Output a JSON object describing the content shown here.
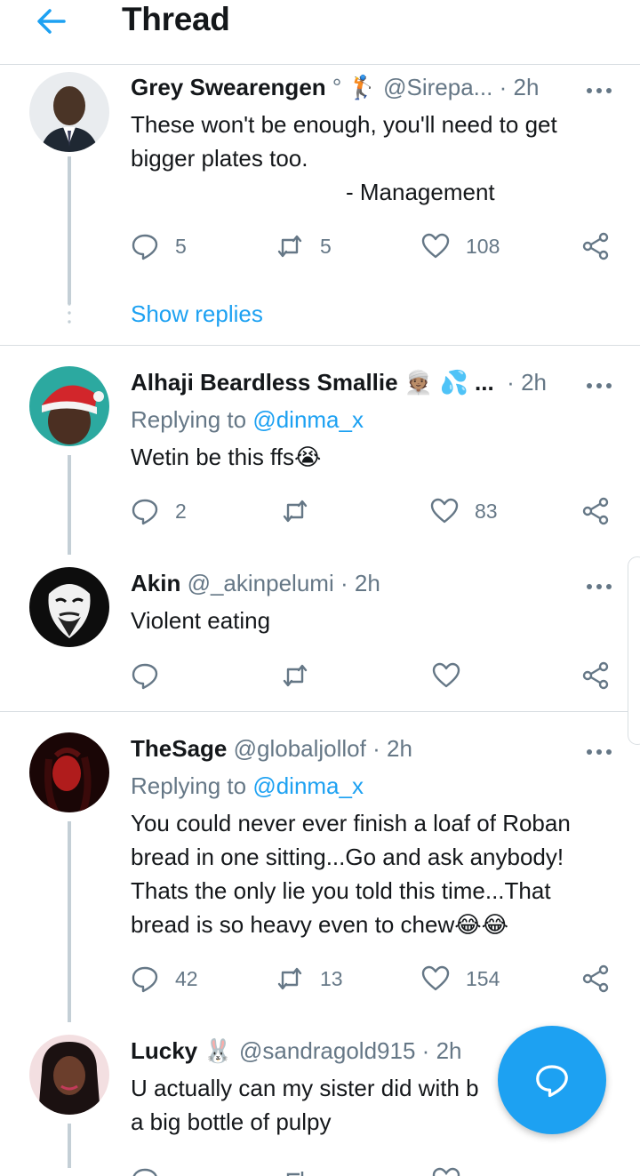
{
  "header": {
    "title": "Thread"
  },
  "tweets": [
    {
      "name": "Grey Swearengen",
      "name_suffix": " ° ",
      "badge": "🏌",
      "handle": "@Sirepa...",
      "time": "2h",
      "lines": [
        "These won't be enough, you'll need to get",
        "bigger plates too."
      ],
      "signature": "- Management",
      "replies": "5",
      "retweets": "5",
      "likes": "108"
    },
    {
      "name": "Alhaji Beardless Smallie",
      "badge": "👳🏽",
      "badge2": "💦",
      "handle": "...",
      "time": "2h",
      "replying_prefix": "Replying to ",
      "replying_to": "@dinma_x",
      "text": "Wetin be this ffs",
      "emoji": "😭",
      "replies": "2",
      "retweets": "",
      "likes": "83"
    },
    {
      "name": "Akin",
      "handle": "@_akinpelumi",
      "time": "2h",
      "text": "Violent eating",
      "replies": "",
      "retweets": "",
      "likes": ""
    },
    {
      "name": "TheSage",
      "handle": "@globaljollof",
      "time": "2h",
      "replying_prefix": "Replying to ",
      "replying_to": "@dinma_x",
      "lines": [
        "You could never ever finish a loaf of Roban",
        "bread in one sitting...Go and ask anybody!",
        "Thats the only lie you told this time...That",
        "bread is so heavy even to chew"
      ],
      "emoji": "😂😂",
      "replies": "42",
      "retweets": "13",
      "likes": "154"
    },
    {
      "name": "Lucky",
      "badge": "🐰",
      "handle": "@sandragold915",
      "time": "2h",
      "lines": [
        "U actually can my sister did with b",
        "a big bottle of pulpy"
      ]
    }
  ],
  "show_replies": "Show replies",
  "dot_sep": "·",
  "icons": {
    "back": "back-arrow-icon",
    "more": "more-icon",
    "reply": "reply-icon",
    "retweet": "retweet-icon",
    "like": "like-icon",
    "share": "share-icon",
    "compose": "compose-reply-icon"
  },
  "colors": {
    "accent": "#1da1f2",
    "muted": "#657786",
    "text": "#14171a",
    "line": "#c4cfd6"
  }
}
